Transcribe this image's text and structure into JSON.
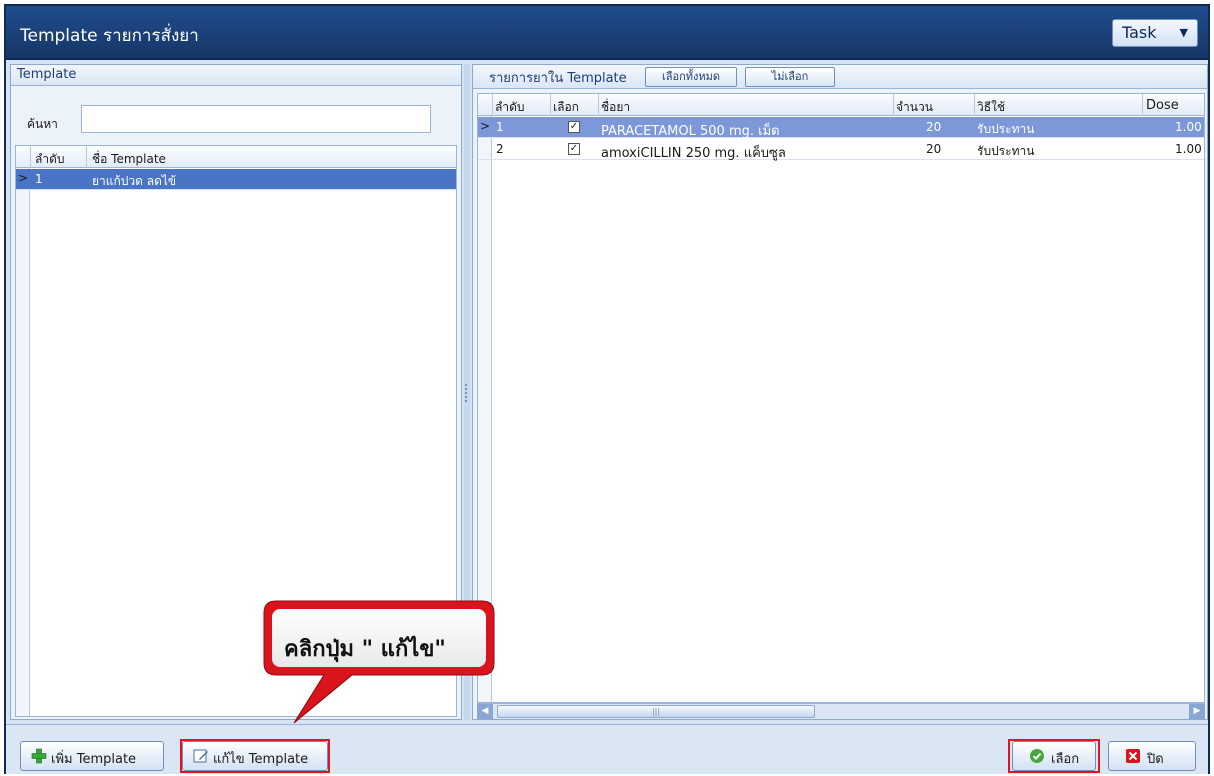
{
  "window": {
    "title": "Template รายการสั่งยา",
    "task_button": "Task"
  },
  "left_panel": {
    "header": "Template",
    "search_label": "ค้นหา",
    "search_value": "",
    "columns": [
      "ลำดับ",
      "ชื่อ Template"
    ],
    "rows": [
      {
        "no": "1",
        "name": "ยาแก้ปวด ลดไข้"
      }
    ]
  },
  "right_panel": {
    "header": "รายการยาใน Template",
    "select_all_button": "เลือกทั้งหมด",
    "deselect_button": "ไม่เลือก",
    "columns": [
      "ลำดับ",
      "เลือก",
      "ชื่อยา",
      "จำนวน",
      "วิธีใช้",
      "Dose"
    ],
    "rows": [
      {
        "no": "1",
        "checked": "✓",
        "drug": "PARACETAMOL 500 mg. เม็ด",
        "qty": "20",
        "usage": "รับประทาน",
        "dose": "1.00"
      },
      {
        "no": "2",
        "checked": "✓",
        "drug": "amoxiCILLIN 250 mg. แค็บซูล",
        "qty": "20",
        "usage": "รับประทาน",
        "dose": "1.00"
      }
    ]
  },
  "footer": {
    "add_button": "เพิ่ม Template",
    "edit_button": "แก้ไข Template",
    "select_button": "เลือก",
    "close_button": "ปิด"
  },
  "callout": {
    "text": "คลิกปุ่ม \" แก้ไข\""
  },
  "colors": {
    "title_bar": "#1a3f76",
    "selection": "#4a74c6",
    "highlight_red": "#e0141e",
    "callout_red": "#d9141c"
  }
}
